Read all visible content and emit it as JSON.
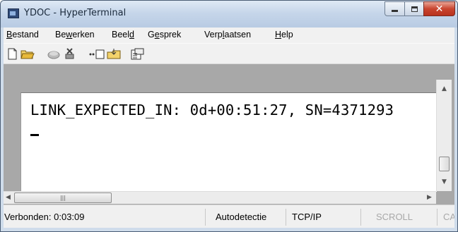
{
  "window": {
    "title": "YDOC - HyperTerminal"
  },
  "menu": [
    {
      "pre": "",
      "u": "B",
      "post": "estand"
    },
    {
      "pre": "Be",
      "u": "w",
      "post": "erken"
    },
    {
      "pre": "Beel",
      "u": "d",
      "post": ""
    },
    {
      "pre": "G",
      "u": "e",
      "post": "sprek"
    },
    {
      "pre": "Verp",
      "u": "l",
      "post": "aatsen"
    },
    {
      "pre": "",
      "u": "H",
      "post": "elp"
    }
  ],
  "toolbar": [
    "new-icon",
    "open-icon",
    "connect-icon",
    "disconnect-icon",
    "send-icon",
    "receive-icon",
    "properties-icon"
  ],
  "terminal": {
    "line1": "LINK_EXPECTED_IN: 0d+00:51:27, SN=4371293"
  },
  "status": {
    "connected": "Verbonden: 0:03:09",
    "detect": "Autodetectie",
    "protocol": "TCP/IP",
    "scroll": "SCROLL",
    "caps": "CA"
  },
  "colors": {
    "titlebar": "#c6d6ea",
    "close": "#c9452f",
    "frame": "#a8a8a8"
  }
}
